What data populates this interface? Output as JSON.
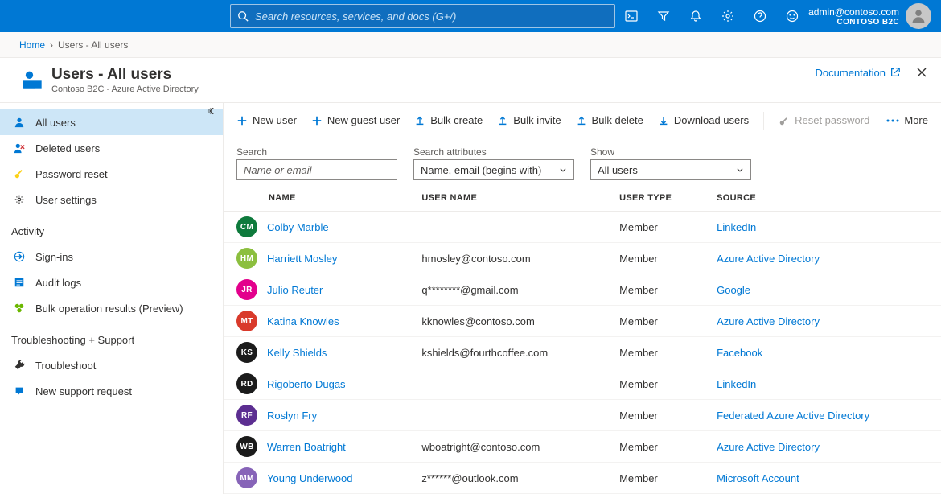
{
  "top": {
    "search_placeholder": "Search resources, services, and docs (G+/)",
    "account_email": "admin@contoso.com",
    "tenant": "CONTOSO B2C"
  },
  "breadcrumb": {
    "root": "Home",
    "current": "Users - All users"
  },
  "blade": {
    "title": "Users - All users",
    "subtitle": "Contoso B2C - Azure Active Directory",
    "doc_label": "Documentation"
  },
  "sidebar": {
    "manage": [
      {
        "key": "all-users",
        "label": "All users",
        "active": true
      },
      {
        "key": "deleted-users",
        "label": "Deleted users",
        "active": false
      },
      {
        "key": "password-reset",
        "label": "Password reset",
        "active": false
      },
      {
        "key": "user-settings",
        "label": "User settings",
        "active": false
      }
    ],
    "activity_header": "Activity",
    "activity": [
      {
        "key": "signins",
        "label": "Sign-ins"
      },
      {
        "key": "audit",
        "label": "Audit logs"
      },
      {
        "key": "bulk-results",
        "label": "Bulk operation results (Preview)"
      }
    ],
    "troubleshoot_header": "Troubleshooting + Support",
    "troubleshoot": [
      {
        "key": "troubleshoot",
        "label": "Troubleshoot"
      },
      {
        "key": "support",
        "label": "New support request"
      }
    ]
  },
  "commands": {
    "new_user": "New user",
    "new_guest": "New guest user",
    "bulk_create": "Bulk create",
    "bulk_invite": "Bulk invite",
    "bulk_delete": "Bulk delete",
    "download": "Download users",
    "reset_pw": "Reset password",
    "more": "More"
  },
  "filters": {
    "search_label": "Search",
    "search_placeholder": "Name or email",
    "attr_label": "Search attributes",
    "attr_value": "Name, email (begins with)",
    "show_label": "Show",
    "show_value": "All users"
  },
  "table": {
    "headers": {
      "name": "Name",
      "username": "User name",
      "usertype": "User type",
      "source": "Source"
    },
    "rows": [
      {
        "initials": "CM",
        "color": "#0e7a3c",
        "name": "Colby Marble",
        "username": "",
        "usertype": "Member",
        "source": "LinkedIn"
      },
      {
        "initials": "HM",
        "color": "#8cbf3f",
        "name": "Harriett Mosley",
        "username": "hmosley@contoso.com",
        "usertype": "Member",
        "source": "Azure Active Directory"
      },
      {
        "initials": "JR",
        "color": "#e3008c",
        "name": "Julio Reuter",
        "username": "q********@gmail.com",
        "usertype": "Member",
        "source": "Google"
      },
      {
        "initials": "MT",
        "color": "#d93a2b",
        "name": "Katina Knowles",
        "username": "kknowles@contoso.com",
        "usertype": "Member",
        "source": "Azure Active Directory"
      },
      {
        "initials": "KS",
        "color": "#1b1b1b",
        "name": "Kelly Shields",
        "username": "kshields@fourthcoffee.com",
        "usertype": "Member",
        "source": "Facebook"
      },
      {
        "initials": "RD",
        "color": "#1b1b1b",
        "name": "Rigoberto Dugas",
        "username": "",
        "usertype": "Member",
        "source": "LinkedIn"
      },
      {
        "initials": "RF",
        "color": "#5c2e91",
        "name": "Roslyn Fry",
        "username": "",
        "usertype": "Member",
        "source": "Federated Azure Active Directory"
      },
      {
        "initials": "WB",
        "color": "#1b1b1b",
        "name": "Warren Boatright",
        "username": "wboatright@contoso.com",
        "usertype": "Member",
        "source": "Azure Active Directory"
      },
      {
        "initials": "MM",
        "color": "#8764b8",
        "name": "Young Underwood",
        "username": "z******@outlook.com",
        "usertype": "Member",
        "source": "Microsoft Account"
      }
    ]
  }
}
